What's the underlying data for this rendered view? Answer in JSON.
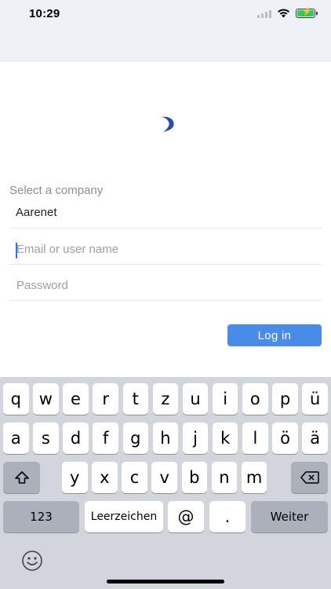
{
  "status_bar": {
    "time": "10:29"
  },
  "form": {
    "company_label": "Select a company",
    "company_value": "Aarenet",
    "email_placeholder": "Email or user name",
    "password_placeholder": "Password",
    "login_label": "Log in"
  },
  "keyboard": {
    "row1": [
      "q",
      "w",
      "e",
      "r",
      "t",
      "z",
      "u",
      "i",
      "o",
      "p",
      "ü"
    ],
    "row2": [
      "a",
      "s",
      "d",
      "f",
      "g",
      "h",
      "j",
      "k",
      "l",
      "ö",
      "ä"
    ],
    "row3": [
      "y",
      "x",
      "c",
      "v",
      "b",
      "n",
      "m"
    ],
    "numbers_label": "123",
    "space_label": "Leerzeichen",
    "at_label": "@",
    "dot_label": ".",
    "return_label": "Weiter"
  },
  "colors": {
    "accent": "#4a8be8",
    "keyboard_bg": "#d2d5db",
    "logo": "#2b4fa3"
  }
}
